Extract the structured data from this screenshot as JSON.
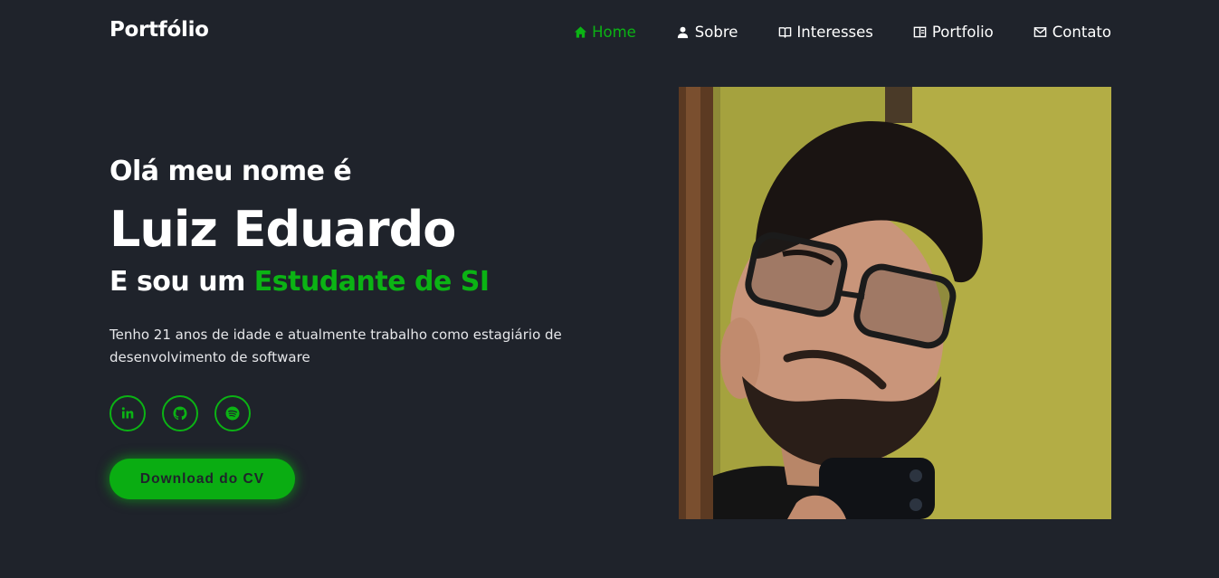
{
  "header": {
    "logo": "Portfólio",
    "nav": [
      {
        "label": "Home",
        "icon": "home-icon",
        "active": true
      },
      {
        "label": "Sobre",
        "icon": "user-icon",
        "active": false
      },
      {
        "label": "Interesses",
        "icon": "book-icon",
        "active": false
      },
      {
        "label": "Portfolio",
        "icon": "layout-icon",
        "active": false
      },
      {
        "label": "Contato",
        "icon": "mail-icon",
        "active": false
      }
    ]
  },
  "hero": {
    "greeting": "Olá meu nome é",
    "name": "Luiz Eduardo",
    "role_prefix": "E sou um",
    "role_highlight": "Estudante de SI",
    "description": "Tenho 21 anos de idade e atualmente trabalho como estagiário de desenvolvimento de software",
    "socials": [
      {
        "icon": "linkedin-icon"
      },
      {
        "icon": "github-icon"
      },
      {
        "icon": "spotify-icon"
      }
    ],
    "cv_button": "Download do CV"
  },
  "colors": {
    "background": "#1f232b",
    "accent": "#0bb314",
    "text": "#ffffff"
  }
}
